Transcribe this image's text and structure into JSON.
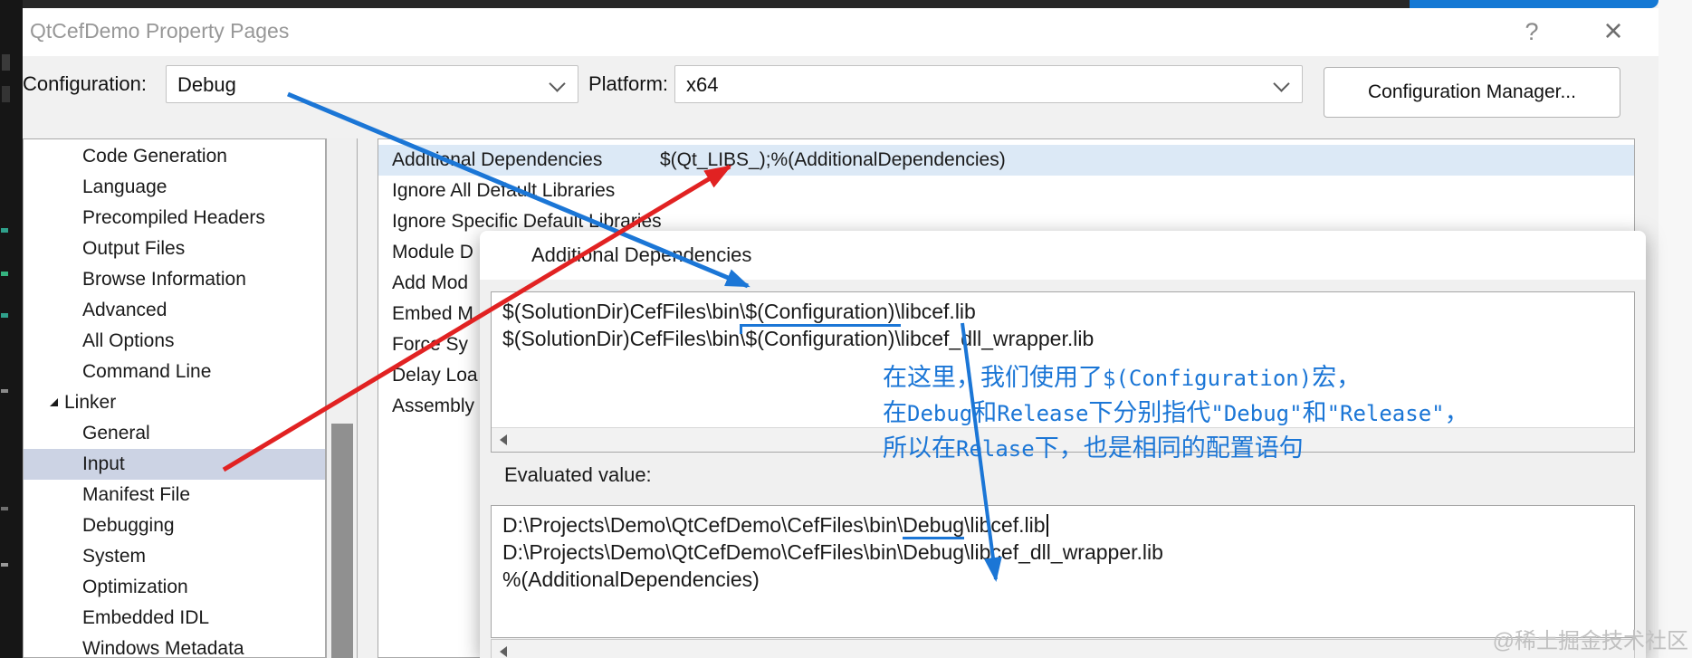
{
  "window": {
    "title": "QtCefDemo Property Pages",
    "help": "?",
    "close": "×"
  },
  "toolbar": {
    "configuration_label": "Configuration:",
    "configuration_value": "Debug",
    "platform_label": "Platform:",
    "platform_value": "x64",
    "manager_button": "Configuration Manager..."
  },
  "sidebar": {
    "items": [
      {
        "label": "Code Generation",
        "indent": 2
      },
      {
        "label": "Language",
        "indent": 2
      },
      {
        "label": "Precompiled Headers",
        "indent": 2
      },
      {
        "label": "Output Files",
        "indent": 2
      },
      {
        "label": "Browse Information",
        "indent": 2
      },
      {
        "label": "Advanced",
        "indent": 2
      },
      {
        "label": "All Options",
        "indent": 2
      },
      {
        "label": "Command Line",
        "indent": 2
      },
      {
        "label": "Linker",
        "indent": 1,
        "expanded": true
      },
      {
        "label": "General",
        "indent": 2
      },
      {
        "label": "Input",
        "indent": 2,
        "selected": true
      },
      {
        "label": "Manifest File",
        "indent": 2
      },
      {
        "label": "Debugging",
        "indent": 2
      },
      {
        "label": "System",
        "indent": 2
      },
      {
        "label": "Optimization",
        "indent": 2
      },
      {
        "label": "Embedded IDL",
        "indent": 2
      },
      {
        "label": "Windows Metadata",
        "indent": 2
      }
    ]
  },
  "grid": {
    "rows": [
      {
        "label": "Additional Dependencies",
        "value": "$(Qt_LIBS_);%(AdditionalDependencies)",
        "selected": true
      },
      {
        "label": "Ignore All Default Libraries",
        "value": ""
      },
      {
        "label": "Ignore Specific Default Libraries",
        "value": ""
      },
      {
        "label": "Module D",
        "value": ""
      },
      {
        "label": "Add Mod",
        "value": ""
      },
      {
        "label": "Embed M",
        "value": ""
      },
      {
        "label": "Force Sy",
        "value": ""
      },
      {
        "label": "Delay Loa",
        "value": ""
      },
      {
        "label": "Assembly",
        "value": ""
      }
    ]
  },
  "popup": {
    "title": "Additional Dependencies",
    "deps_line1": "$(SolutionDir)CefFiles\\bin\\$(Configuration)\\libcef.lib",
    "deps_line2_pre": "$(SolutionDir)CefFiles\\bin",
    "deps_line2_bracket": "\\$(Configuration)\\",
    "deps_line2_post": "libcef_dll_wrapper.lib",
    "evaluated_label": "Evaluated value:",
    "eval_line1_pre": "D:\\Projects\\Demo\\QtCefDemo\\CefFiles\\bin\\",
    "eval_line1_mark": "Debug",
    "eval_line1_post": "\\libcef.lib",
    "eval_line2": "D:\\Projects\\Demo\\QtCefDemo\\CefFiles\\bin\\Debug\\libcef_dll_wrapper.lib",
    "eval_line3": "%(AdditionalDependencies)"
  },
  "annotations": {
    "blue": "#1b76d6",
    "red": "#e12222",
    "note_l1a": "在这里，我们使用了",
    "note_l1b": "$(Configuration)",
    "note_l1c": "宏，",
    "note_l2a": "在",
    "note_l2b": "Debug",
    "note_l2c": "和",
    "note_l2d": "Release",
    "note_l2e": "下分别指代",
    "note_l2f": "\"Debug\"",
    "note_l2g": "和",
    "note_l2h": "\"Release\"",
    "note_l2i": "，",
    "note_l3a": "所以在",
    "note_l3b": "Relase",
    "note_l3c": "下，也是相同的配置语句"
  },
  "watermark": "@稀土掘金技术社区"
}
